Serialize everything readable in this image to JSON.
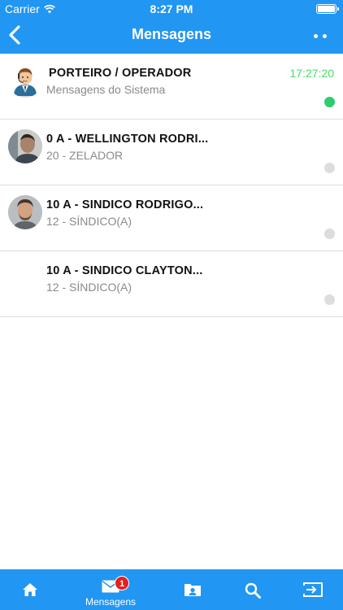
{
  "status_bar": {
    "carrier": "Carrier",
    "time": "8:27 PM",
    "battery_level": 1.0
  },
  "nav": {
    "title": "Mensagens"
  },
  "messages": [
    {
      "name": "PORTEIRO / OPERADOR",
      "subtitle": "Mensagens do Sistema",
      "time": "17:27:20",
      "avatar": "operator-avatar",
      "status_color": "#2ecc71",
      "online": true
    },
    {
      "name": "0 A - WELLINGTON RODRI...",
      "subtitle": "20 - ZELADOR",
      "time": "",
      "avatar": "user-photo",
      "status_color": "#dddddd",
      "online": false
    },
    {
      "name": "10 A - SINDICO RODRIGO...",
      "subtitle": "12 - SÍNDICO(A)",
      "time": "",
      "avatar": "user-photo",
      "status_color": "#dddddd",
      "online": false
    },
    {
      "name": "10 A - SINDICO CLAYTON...",
      "subtitle": "12 - SÍNDICO(A)",
      "time": "",
      "avatar": "none",
      "status_color": "#dddddd",
      "online": false
    }
  ],
  "tabbar": {
    "items": [
      {
        "icon": "home-icon",
        "label": ""
      },
      {
        "icon": "mail-icon",
        "label": "Mensagens",
        "badge": "1",
        "active": true
      },
      {
        "icon": "contacts-icon",
        "label": ""
      },
      {
        "icon": "search-icon",
        "label": ""
      },
      {
        "icon": "logout-icon",
        "label": ""
      }
    ]
  },
  "colors": {
    "primary": "#2196f3",
    "online": "#2ecc71",
    "time": "#4cd964",
    "badge": "#e61e1e"
  }
}
